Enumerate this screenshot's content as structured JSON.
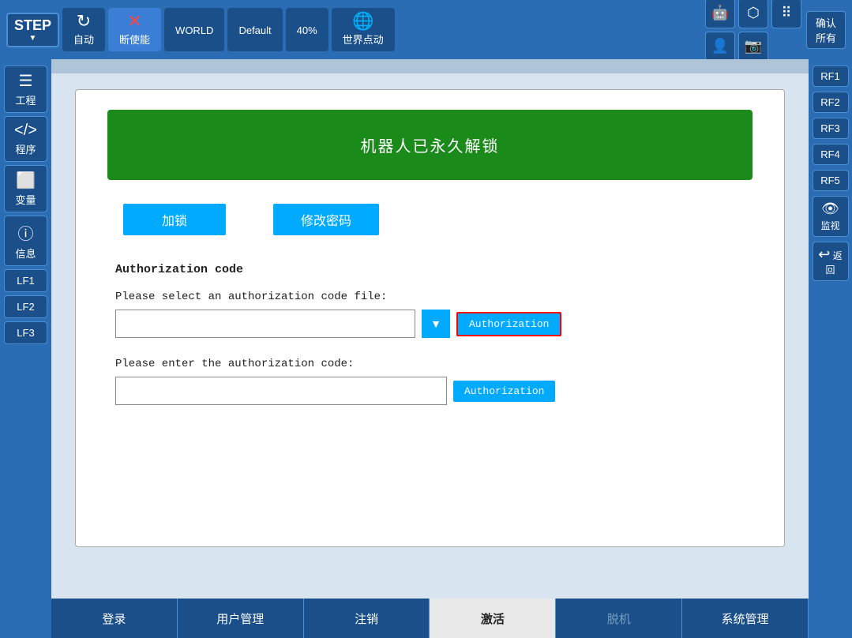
{
  "topbar": {
    "step_label": "STEP",
    "step_sub": "▼",
    "auto_label": "自动",
    "disable_label": "断使能",
    "world_label": "WORLD",
    "default_label": "Default",
    "zoom_label": "40%",
    "world_jog_label": "世界点动",
    "confirm_all": "确认\n所有"
  },
  "sidebar_left": [
    {
      "icon": "☰",
      "label": "工程"
    },
    {
      "icon": "⟨⟩",
      "label": "程序"
    },
    {
      "icon": "◫",
      "label": "变量"
    },
    {
      "icon": "ⓘ",
      "label": "信息"
    },
    {
      "icon": "",
      "label": "LF1"
    },
    {
      "icon": "",
      "label": "LF2"
    },
    {
      "icon": "",
      "label": "LF3"
    }
  ],
  "sidebar_right": [
    {
      "label": "RF1"
    },
    {
      "label": "RF2"
    },
    {
      "label": "RF3"
    },
    {
      "label": "RF4"
    },
    {
      "label": "RF5"
    },
    {
      "icon": "👁",
      "label": "监视"
    },
    {
      "icon": "←",
      "label": "返回"
    }
  ],
  "status_banner": {
    "text": "机器人已永久解锁"
  },
  "action_buttons": {
    "lock": "加锁",
    "change_password": "修改密码"
  },
  "auth_code": {
    "section_title": "Authorization code",
    "file_label": "Please select an authorization code file:",
    "file_placeholder": "",
    "file_btn": "Authorization",
    "code_label": "Please enter the authorization code:",
    "code_placeholder": "",
    "code_btn": "Authorization"
  },
  "bottom_tabs": [
    {
      "label": "登录",
      "active": false,
      "disabled": false
    },
    {
      "label": "用户管理",
      "active": false,
      "disabled": false
    },
    {
      "label": "注销",
      "active": false,
      "disabled": false
    },
    {
      "label": "激活",
      "active": true,
      "disabled": false
    },
    {
      "label": "脱机",
      "active": false,
      "disabled": true
    },
    {
      "label": "系统管理",
      "active": false,
      "disabled": false
    }
  ]
}
